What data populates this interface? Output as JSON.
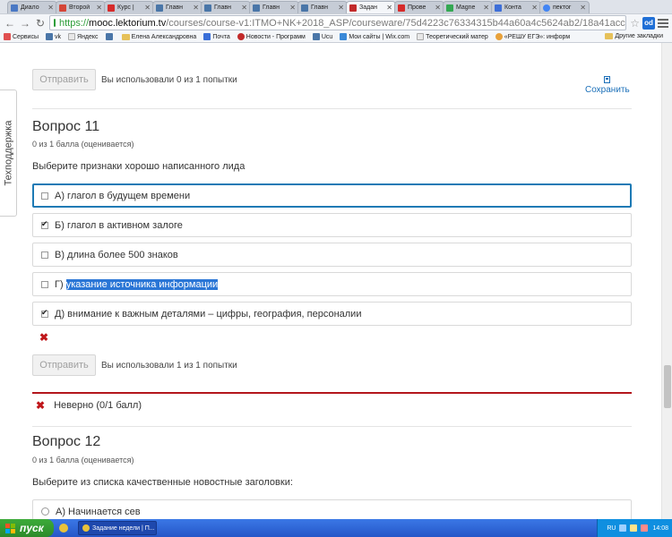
{
  "browser": {
    "tabs": [
      {
        "label": "Диало",
        "icon": "chat-icon",
        "color": "#4a78c4"
      },
      {
        "label": "Второй",
        "icon": "gmail-icon",
        "color": "#d44638"
      },
      {
        "label": "Курс |",
        "icon": "youtube-icon",
        "color": "#d62b2b"
      },
      {
        "label": "Главн",
        "icon": "vk-icon",
        "color": "#4a76a8"
      },
      {
        "label": "Главн",
        "icon": "vk-icon",
        "color": "#4a76a8"
      },
      {
        "label": "Главн",
        "icon": "vk-icon",
        "color": "#4a76a8"
      },
      {
        "label": "Главн",
        "icon": "vk-icon",
        "color": "#4a76a8"
      },
      {
        "label": "Задан",
        "icon": "lektorium-icon",
        "color": "#c22a2a",
        "active": true
      },
      {
        "label": "Прове",
        "icon": "youtube-icon",
        "color": "#d62b2b"
      },
      {
        "label": "Magne",
        "icon": "maps-icon",
        "color": "#34a853"
      },
      {
        "label": "Конта",
        "icon": "contact-icon",
        "color": "#3e6fd8"
      },
      {
        "label": "пектог",
        "icon": "google-icon",
        "color": "#4285f4"
      }
    ],
    "url_scheme": "https://",
    "url_host": "mooc.lektorium.tv",
    "url_path": "/courses/course-v1:ITMO+NK+2018_ASP/courseware/75d4223c76334315b44a60a4c5624ab2/18a41acc185b4ebdbcd6d",
    "ext_label": "od",
    "bookmarks": [
      {
        "label": "Сервисы",
        "icon": "apps-icon",
        "color": "#e05050"
      },
      {
        "label": "vk",
        "icon": "vk-icon",
        "color": "#4a76a8"
      },
      {
        "label": "Яндекс",
        "icon": "yandex-icon",
        "color": "#e8e8e8"
      },
      {
        "label": "",
        "icon": "vk-icon",
        "color": "#4a76a8"
      },
      {
        "label": "Елена Александровна",
        "icon": "folder-icon",
        "color": "#e6c15a"
      },
      {
        "label": "Почта",
        "icon": "mail-icon",
        "color": "#3a6fd8"
      },
      {
        "label": "Новости - Программ",
        "icon": "news-icon",
        "color": "#c22a2a"
      },
      {
        "label": "Ucu",
        "icon": "ucu-icon",
        "color": "#4a76a8"
      },
      {
        "label": "Мои сайты | Wix.com",
        "icon": "wix-icon",
        "color": "#3a89d8"
      },
      {
        "label": "Теоретический матер",
        "icon": "doc-icon",
        "color": "#e8e8e8"
      },
      {
        "label": "«РЕШУ ЕГЭ»: информ",
        "icon": "reshu-icon",
        "color": "#e8a13a"
      }
    ],
    "other_bookmarks": "Другие закладки"
  },
  "page": {
    "support_tab": "Техподдержка",
    "prev_submit": {
      "button": "Отправить",
      "attempts": "Вы использовали 0 из 1 попытки"
    },
    "save_label": "Сохранить",
    "question11": {
      "title": "Вопрос 11",
      "points": "0 из 1 балла (оценивается)",
      "prompt": "Выберите признаки хорошо написанного лида",
      "options": [
        {
          "text": "А) глагол в будущем времени",
          "checked": false
        },
        {
          "text": "Б) глагол в активном залоге",
          "checked": true
        },
        {
          "text": "В) длина более 500 знаков",
          "checked": false
        },
        {
          "prefix": "Г) ",
          "highlight": "указание источника информации",
          "checked": false
        },
        {
          "text": "Д) внимание к важным деталями – цифры, география, персоналии",
          "checked": true
        }
      ],
      "submit": {
        "button": "Отправить",
        "attempts": "Вы использовали 1 из 1 попытки"
      },
      "feedback": "Неверно (0/1 балл)"
    },
    "question12": {
      "title": "Вопрос 12",
      "points": "0 из 1 балла (оценивается)",
      "prompt": "Выберите из списка качественные новостные заголовки:",
      "options": [
        {
          "text": "А) Начинается сев"
        }
      ]
    }
  },
  "taskbar": {
    "start": "пуск",
    "task": "Задание недели | П...",
    "lang": "RU",
    "time": "14:08"
  },
  "colors": {
    "accent": "#1d7ab5",
    "error": "#c0171b",
    "feedback_border": "#b3171d",
    "link": "#1a6fb8"
  }
}
